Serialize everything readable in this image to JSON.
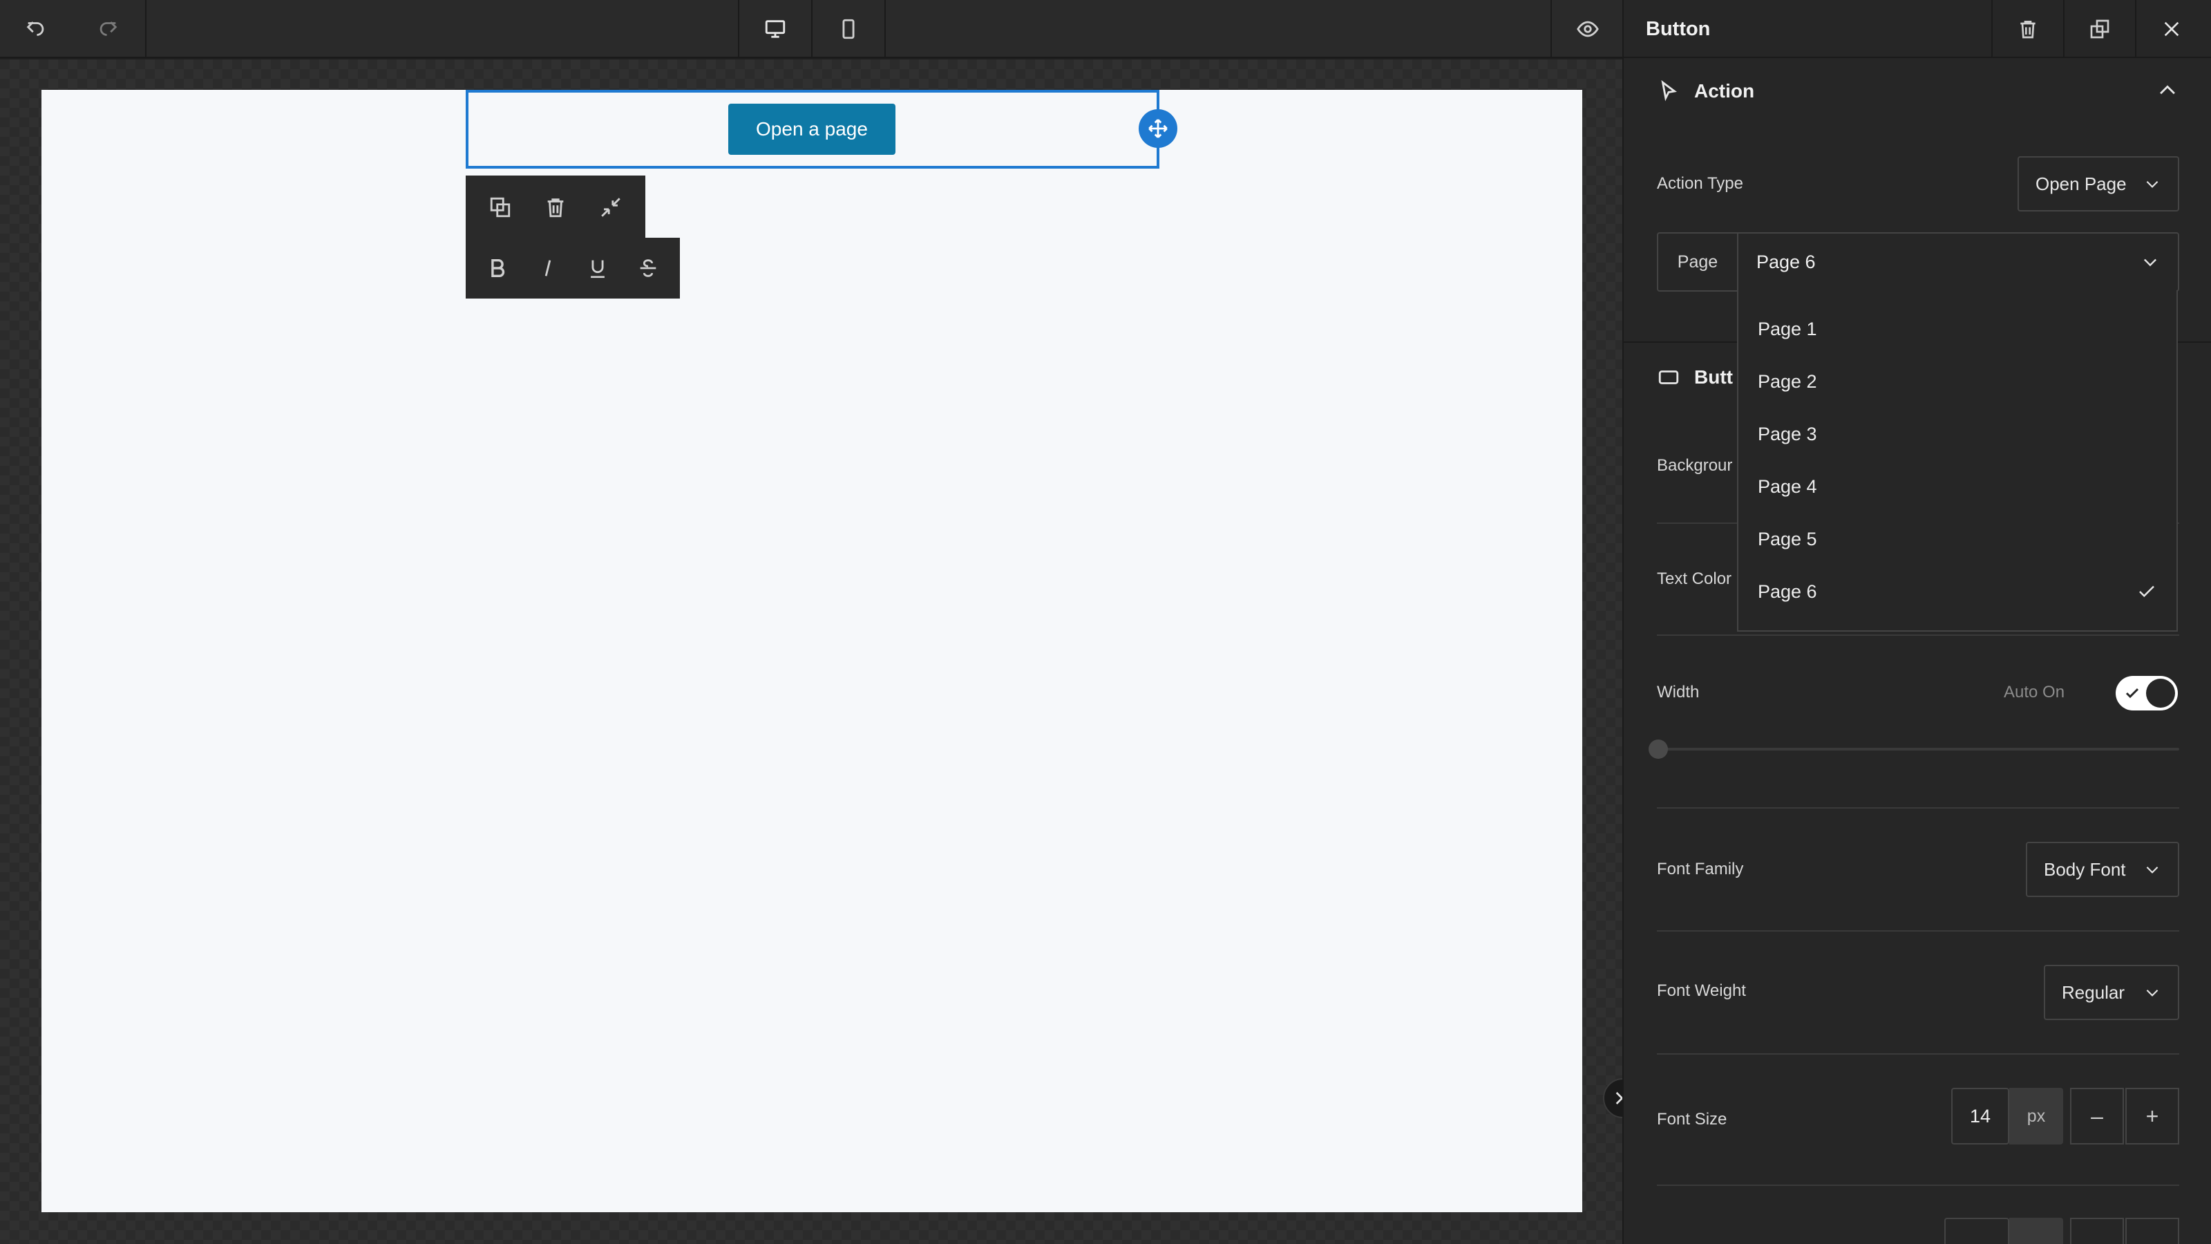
{
  "toolbar": {
    "undo_icon": "undo-icon",
    "redo_icon": "redo-icon",
    "desktop_icon": "desktop-icon",
    "mobile_icon": "mobile-icon",
    "preview_icon": "eye-icon"
  },
  "canvas": {
    "button_label": "Open a page",
    "move_icon": "move-icon",
    "tools_row1": [
      "duplicate-icon",
      "trash-icon",
      "collapse-icon"
    ],
    "tools_row2": [
      "bold-icon",
      "italic-icon",
      "underline-icon",
      "strikethrough-icon"
    ],
    "collapse_panel_icon": "double-chevron-right-icon"
  },
  "panel": {
    "title": "Button",
    "header_actions": [
      "trash-icon",
      "duplicate-icon",
      "close-icon"
    ],
    "action_section": {
      "label": "Action",
      "icon": "cursor-icon",
      "action_type_label": "Action Type",
      "action_type_value": "Open Page",
      "page_label": "Page",
      "page_value": "Page 6"
    },
    "page_options": [
      "Page 1",
      "Page 2",
      "Page 3",
      "Page 4",
      "Page 5",
      "Page 6"
    ],
    "selected_page": "Page 6",
    "button_section": {
      "label_partial": "Butt",
      "background_label_partial": "Backgrour",
      "text_color_label": "Text Color"
    },
    "width": {
      "label": "Width",
      "auto_label": "Auto On",
      "auto_on": true,
      "slider_value": 0
    },
    "font_family": {
      "label": "Font Family",
      "value": "Body Font"
    },
    "font_weight": {
      "label": "Font Weight",
      "value": "Regular"
    },
    "font_size": {
      "label": "Font Size",
      "value": "14",
      "unit": "px",
      "minus": "–",
      "plus": "+"
    }
  },
  "colors": {
    "accent": "#1f7ad1",
    "button_bg": "#0e79a6",
    "panel_bg": "#262626"
  }
}
